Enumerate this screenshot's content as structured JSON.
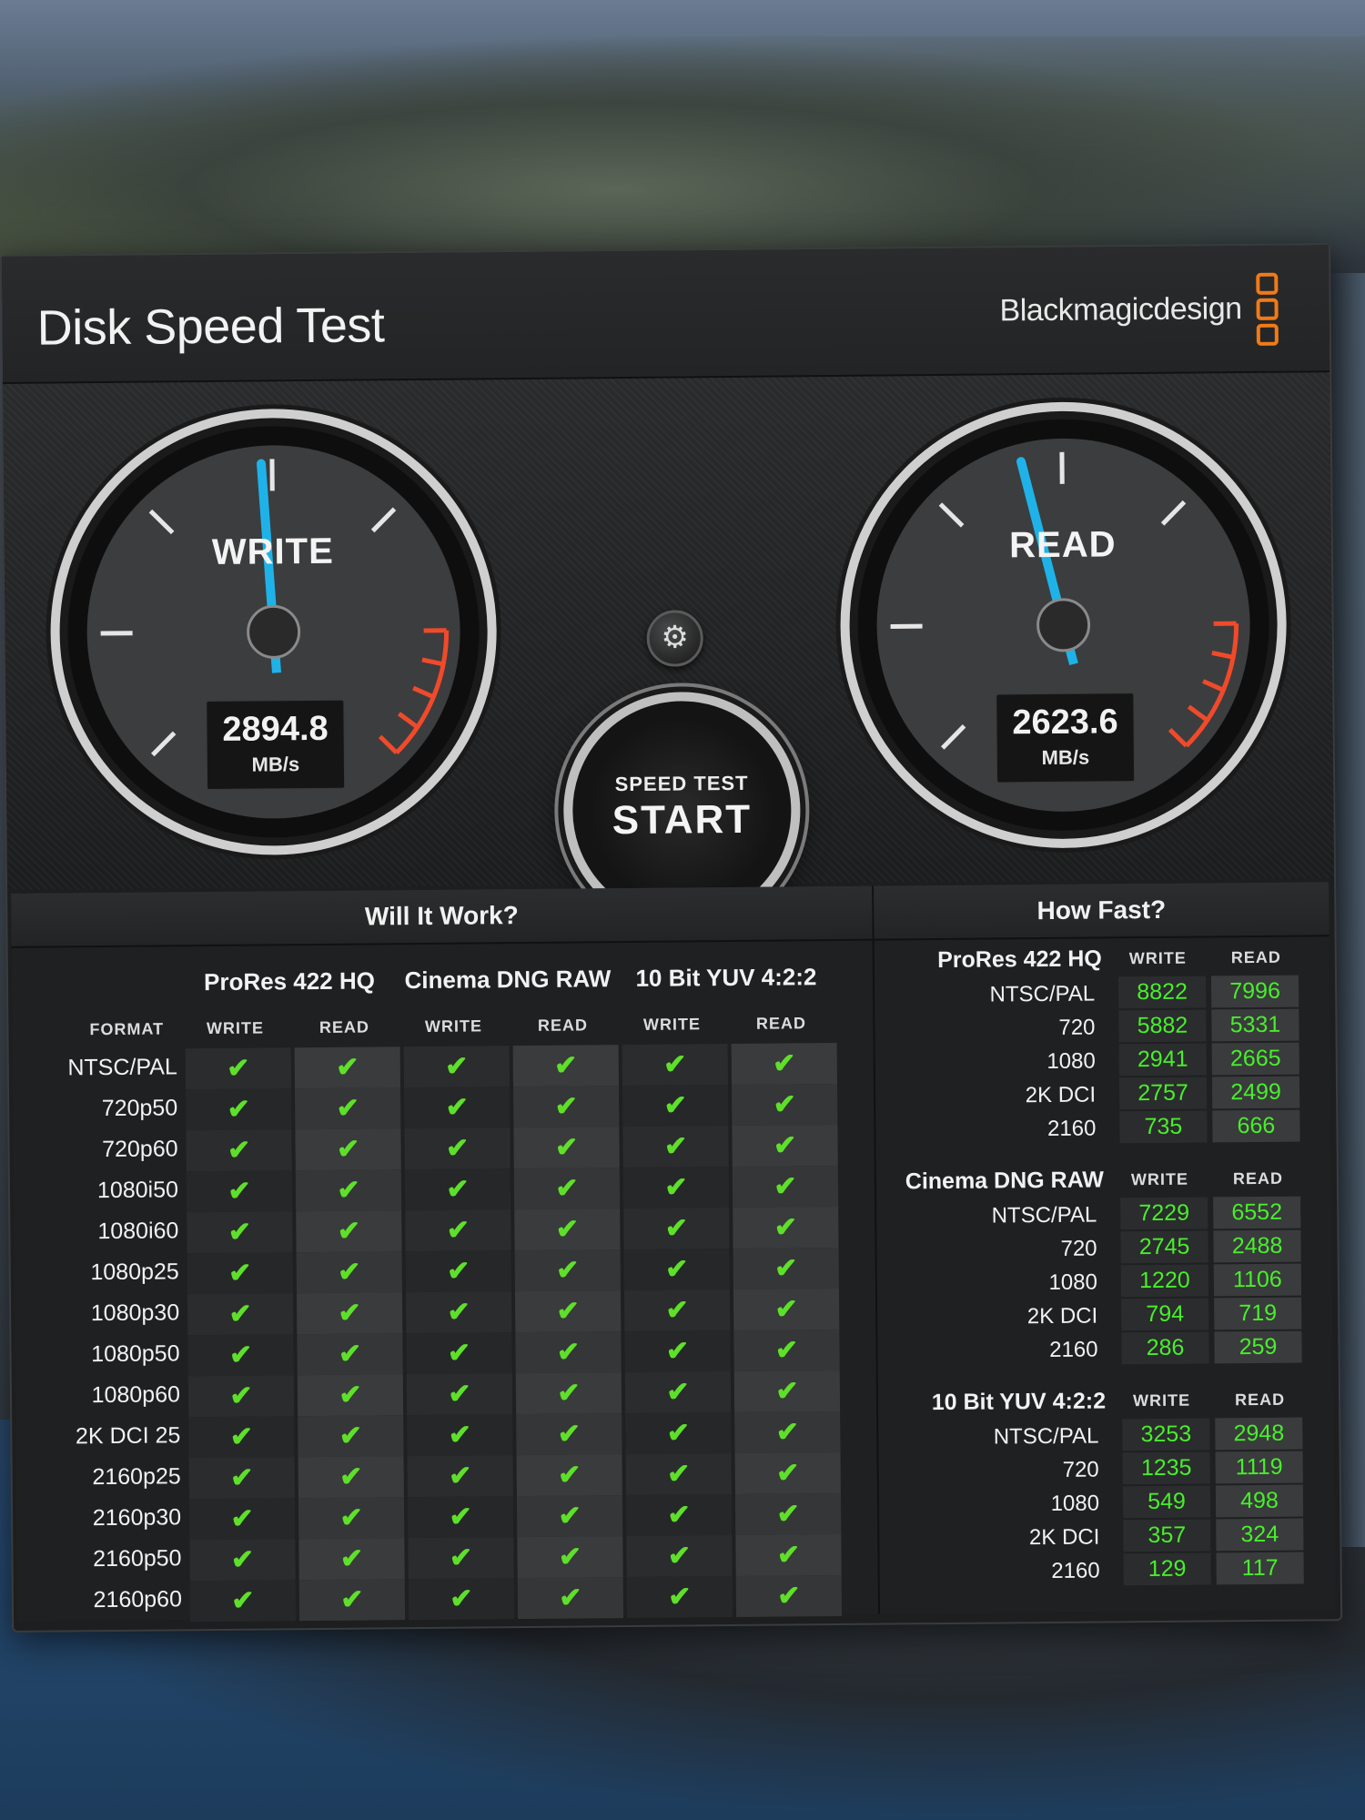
{
  "app": {
    "title": "Disk Speed Test",
    "brand": "Blackmagicdesign"
  },
  "colors": {
    "needle": "#1fb2e8",
    "redline": "#f04a2a",
    "check": "#5ee02a",
    "value": "#48ee2c",
    "brand_accent": "#f07a18"
  },
  "gauges": {
    "write": {
      "label": "WRITE",
      "value": "2894.8",
      "unit": "MB/s"
    },
    "read": {
      "label": "READ",
      "value": "2623.6",
      "unit": "MB/s"
    }
  },
  "start_button": {
    "line1": "SPEED TEST",
    "line2": "START"
  },
  "settings_icon": "gear-icon",
  "will_it_work": {
    "title": "Will It Work?",
    "format_label": "FORMAT",
    "groups": [
      {
        "name": "ProRes 422 HQ",
        "write": "WRITE",
        "read": "READ"
      },
      {
        "name": "Cinema DNG RAW",
        "write": "WRITE",
        "read": "READ"
      },
      {
        "name": "10 Bit YUV 4:2:2",
        "write": "WRITE",
        "read": "READ"
      }
    ],
    "check": "✔",
    "rows": [
      {
        "format": "NTSC/PAL"
      },
      {
        "format": "720p50"
      },
      {
        "format": "720p60"
      },
      {
        "format": "1080i50"
      },
      {
        "format": "1080i60"
      },
      {
        "format": "1080p25"
      },
      {
        "format": "1080p30"
      },
      {
        "format": "1080p50"
      },
      {
        "format": "1080p60"
      },
      {
        "format": "2K DCI 25"
      },
      {
        "format": "2160p25"
      },
      {
        "format": "2160p30"
      },
      {
        "format": "2160p50"
      },
      {
        "format": "2160p60"
      }
    ]
  },
  "how_fast": {
    "title": "How Fast?",
    "write_label": "WRITE",
    "read_label": "READ",
    "groups": [
      {
        "name": "ProRes 422 HQ",
        "rows": [
          {
            "res": "NTSC/PAL",
            "write": "8822",
            "read": "7996"
          },
          {
            "res": "720",
            "write": "5882",
            "read": "5331"
          },
          {
            "res": "1080",
            "write": "2941",
            "read": "2665"
          },
          {
            "res": "2K DCI",
            "write": "2757",
            "read": "2499"
          },
          {
            "res": "2160",
            "write": "735",
            "read": "666"
          }
        ]
      },
      {
        "name": "Cinema DNG RAW",
        "rows": [
          {
            "res": "NTSC/PAL",
            "write": "7229",
            "read": "6552"
          },
          {
            "res": "720",
            "write": "2745",
            "read": "2488"
          },
          {
            "res": "1080",
            "write": "1220",
            "read": "1106"
          },
          {
            "res": "2K DCI",
            "write": "794",
            "read": "719"
          },
          {
            "res": "2160",
            "write": "286",
            "read": "259"
          }
        ]
      },
      {
        "name": "10 Bit YUV 4:2:2",
        "rows": [
          {
            "res": "NTSC/PAL",
            "write": "3253",
            "read": "2948"
          },
          {
            "res": "720",
            "write": "1235",
            "read": "1119"
          },
          {
            "res": "1080",
            "write": "549",
            "read": "498"
          },
          {
            "res": "2K DCI",
            "write": "357",
            "read": "324"
          },
          {
            "res": "2160",
            "write": "129",
            "read": "117"
          }
        ]
      }
    ]
  }
}
